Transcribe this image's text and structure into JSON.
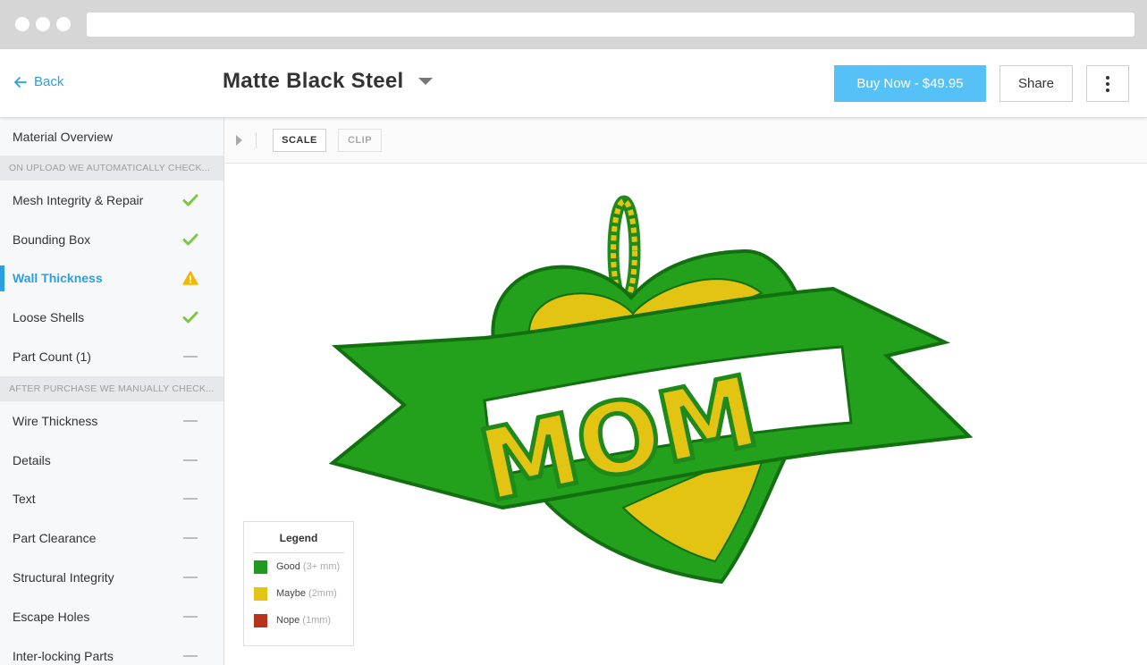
{
  "header": {
    "back_label": "Back",
    "title": "Matte Black Steel",
    "buy_label": "Buy Now - $49.95",
    "share_label": "Share"
  },
  "sidebar": {
    "overview": "Material Overview",
    "section_auto": "ON UPLOAD WE AUTOMATICALLY CHECK...",
    "auto_items": [
      {
        "label": "Mesh Integrity & Repair",
        "status": "check-icon"
      },
      {
        "label": "Bounding Box",
        "status": "check-icon"
      },
      {
        "label": "Wall Thickness",
        "status": "warning-icon"
      },
      {
        "label": "Loose Shells",
        "status": "check-icon"
      },
      {
        "label": "Part Count (1)",
        "status": "dash-icon"
      }
    ],
    "section_manual": "AFTER PURCHASE WE MANUALLY CHECK...",
    "manual_items": [
      {
        "label": "Wire Thickness",
        "status": "dash-icon"
      },
      {
        "label": "Details",
        "status": "dash-icon"
      },
      {
        "label": "Text",
        "status": "dash-icon"
      },
      {
        "label": "Part Clearance",
        "status": "dash-icon"
      },
      {
        "label": "Structural Integrity",
        "status": "dash-icon"
      },
      {
        "label": "Escape Holes",
        "status": "dash-icon"
      },
      {
        "label": "Inter-locking Parts",
        "status": "dash-icon"
      }
    ]
  },
  "toolbar": {
    "scale_label": "SCALE",
    "clip_label": "CLIP"
  },
  "model": {
    "text": "MOM"
  },
  "legend": {
    "title": "Legend",
    "items": [
      {
        "label": "Good",
        "note": "(3+ mm)",
        "color": "#1f9a1f"
      },
      {
        "label": "Maybe",
        "note": "(2mm)",
        "color": "#e3c413"
      },
      {
        "label": "Nope",
        "note": "(1mm)",
        "color": "#b8331c"
      }
    ]
  },
  "colors": {
    "accent": "#2c9fe0",
    "buy_button": "#56c1f6",
    "check": "#7dc742",
    "warning": "#f5b800"
  }
}
